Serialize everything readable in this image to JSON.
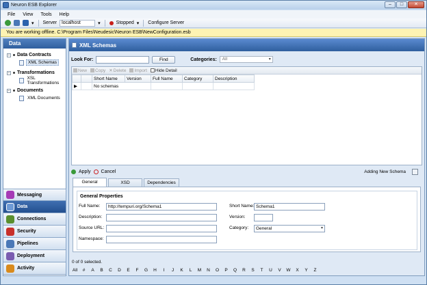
{
  "window": {
    "title": "Neuron ESB Explorer",
    "min": "–",
    "max": "□",
    "close": "✕"
  },
  "menu": [
    "File",
    "View",
    "Tools",
    "Help"
  ],
  "toolbar": {
    "server_label": "Server",
    "server_value": "localhost",
    "status": "Stopped",
    "configure": "Configure Server"
  },
  "offline_notice": "You are working offline. C:\\Program Files\\Neudesic\\Neuron ESB\\NewConfiguration.esb",
  "left": {
    "header": "Data",
    "groups": [
      {
        "label": "Data Contracts",
        "children": [
          "XML Schemas"
        ]
      },
      {
        "label": "Transformations",
        "children": [
          "XSL Transformations"
        ]
      },
      {
        "label": "Documents",
        "children": [
          "XML Documents"
        ]
      }
    ],
    "nav": [
      {
        "label": "Messaging",
        "color": "#a63bb6"
      },
      {
        "label": "Data",
        "color": "#2b62ad"
      },
      {
        "label": "Connections",
        "color": "#5a8f2e"
      },
      {
        "label": "Security",
        "color": "#c8302a"
      },
      {
        "label": "Pipelines",
        "color": "#4a78b7"
      },
      {
        "label": "Deployment",
        "color": "#7a5cb0"
      },
      {
        "label": "Activity",
        "color": "#d98a1c"
      }
    ]
  },
  "main": {
    "header": "XML Schemas",
    "look_for_label": "Look For:",
    "look_for_value": "",
    "find": "Find",
    "categories_label": "Categories:",
    "categories_value": "All",
    "grid_tools": [
      "New",
      "Copy",
      "Delete",
      "Import",
      "Hide Detail"
    ],
    "columns": [
      "Short Name",
      "Version",
      "Full Name",
      "Category",
      "Description"
    ],
    "empty_row": "No schemas",
    "apply": "Apply",
    "cancel": "Cancel",
    "adding": "Adding New Schema",
    "tabs": [
      "General",
      "XSD",
      "Dependencies"
    ],
    "form": {
      "title": "General Properties",
      "full_name_label": "Full Name:",
      "full_name": "http://tempuri.org/Schema1",
      "description_label": "Description:",
      "source_url_label": "Source URL:",
      "namespace_label": "Namespace:",
      "short_name_label": "Short Name:",
      "short_name": "Schema1",
      "version_label": "Version:",
      "category_label": "Category:",
      "category": "General"
    },
    "status": "0 of 0 selected.",
    "alphabet": [
      "All",
      "#",
      "A",
      "B",
      "C",
      "D",
      "E",
      "F",
      "G",
      "H",
      "I",
      "J",
      "K",
      "L",
      "M",
      "N",
      "O",
      "P",
      "Q",
      "R",
      "S",
      "T",
      "U",
      "V",
      "W",
      "X",
      "Y",
      "Z"
    ]
  }
}
